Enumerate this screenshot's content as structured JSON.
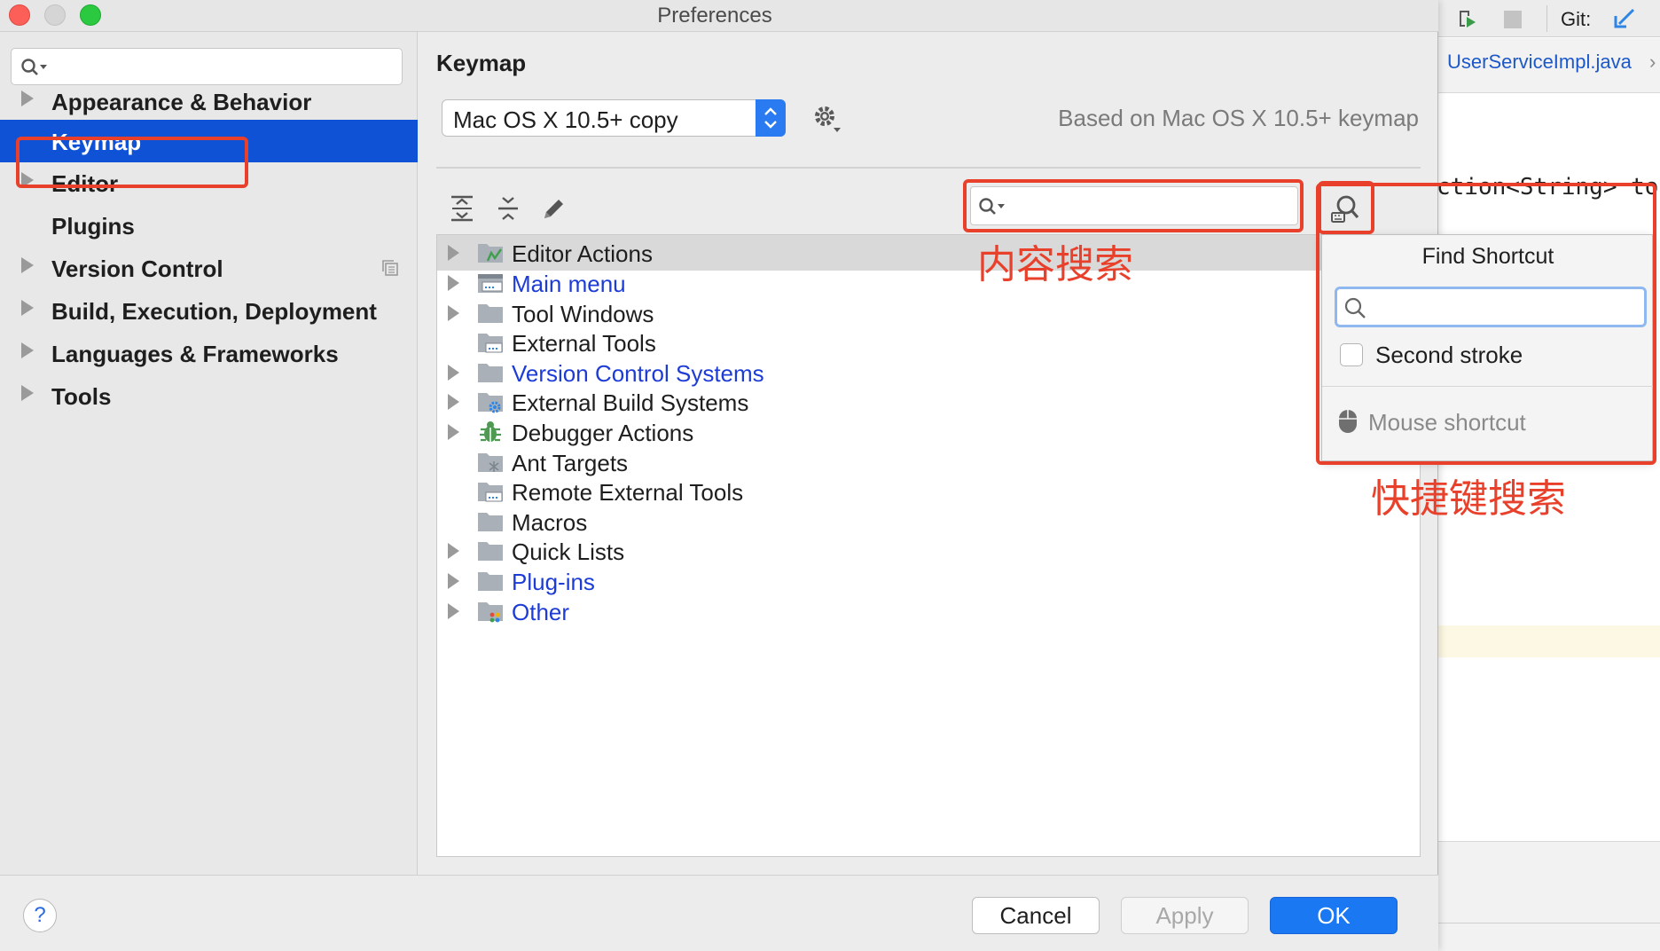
{
  "window": {
    "title": "Preferences"
  },
  "ide": {
    "git_label": "Git:",
    "file_tab": "UserServiceImpl.java",
    "code_line": "ction<String> to"
  },
  "sidebar": {
    "search_placeholder": "",
    "items": [
      {
        "label": "Appearance & Behavior",
        "expandable": true
      },
      {
        "label": "Keymap",
        "expandable": false,
        "selected": true
      },
      {
        "label": "Editor",
        "expandable": true
      },
      {
        "label": "Plugins",
        "expandable": false
      },
      {
        "label": "Version Control",
        "expandable": true
      },
      {
        "label": "Build, Execution, Deployment",
        "expandable": true
      },
      {
        "label": "Languages & Frameworks",
        "expandable": true
      },
      {
        "label": "Tools",
        "expandable": true
      }
    ]
  },
  "content": {
    "title": "Keymap",
    "keymap_select_value": "Mac OS X 10.5+ copy",
    "based_on": "Based on Mac OS X 10.5+ keymap",
    "filter_placeholder": ""
  },
  "tree": {
    "rows": [
      {
        "label": "Editor Actions",
        "expandable": true,
        "link": false,
        "icon": "editor-actions-icon"
      },
      {
        "label": "Main menu",
        "expandable": true,
        "link": true,
        "icon": "main-menu-icon"
      },
      {
        "label": "Tool Windows",
        "expandable": true,
        "link": false,
        "icon": "folder-icon"
      },
      {
        "label": "External Tools",
        "expandable": false,
        "link": false,
        "icon": "external-tools-icon"
      },
      {
        "label": "Version Control Systems",
        "expandable": true,
        "link": true,
        "icon": "folder-icon"
      },
      {
        "label": "External Build Systems",
        "expandable": true,
        "link": false,
        "icon": "build-systems-icon"
      },
      {
        "label": "Debugger Actions",
        "expandable": true,
        "link": false,
        "icon": "bug-icon"
      },
      {
        "label": "Ant Targets",
        "expandable": false,
        "link": false,
        "icon": "ant-icon"
      },
      {
        "label": "Remote External Tools",
        "expandable": false,
        "link": false,
        "icon": "external-tools-icon"
      },
      {
        "label": "Macros",
        "expandable": false,
        "link": false,
        "icon": "folder-icon"
      },
      {
        "label": "Quick Lists",
        "expandable": true,
        "link": false,
        "icon": "folder-icon"
      },
      {
        "label": "Plug-ins",
        "expandable": true,
        "link": true,
        "icon": "folder-icon"
      },
      {
        "label": "Other",
        "expandable": true,
        "link": true,
        "icon": "other-icon"
      }
    ]
  },
  "popup": {
    "title": "Find Shortcut",
    "input_placeholder": "",
    "second_stroke_label": "Second stroke",
    "mouse_shortcut_label": "Mouse shortcut"
  },
  "annotations": {
    "content_search": "内容搜索",
    "shortcut_search": "快捷键搜索"
  },
  "footer": {
    "help": "?",
    "cancel": "Cancel",
    "apply": "Apply",
    "ok": "OK"
  },
  "colors": {
    "accent": "#0f52d6",
    "link": "#1d3cd6",
    "annotation": "#e8402a",
    "ok_button": "#1a78f2"
  }
}
